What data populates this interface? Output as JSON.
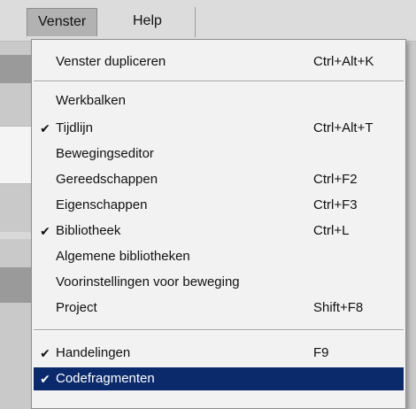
{
  "menubar": {
    "menus": [
      {
        "label": "Venster"
      },
      {
        "label": "Help"
      }
    ]
  },
  "dropdown": {
    "items": [
      {
        "label": "Venster dupliceren",
        "shortcut": "Ctrl+Alt+K",
        "checked": false
      },
      {
        "label": "Werkbalken",
        "shortcut": "",
        "checked": false
      },
      {
        "label": "Tijdlijn",
        "shortcut": "Ctrl+Alt+T",
        "checked": true
      },
      {
        "label": "Bewegingseditor",
        "shortcut": "",
        "checked": false
      },
      {
        "label": "Gereedschappen",
        "shortcut": "Ctrl+F2",
        "checked": false
      },
      {
        "label": "Eigenschappen",
        "shortcut": "Ctrl+F3",
        "checked": false
      },
      {
        "label": "Bibliotheek",
        "shortcut": "Ctrl+L",
        "checked": true
      },
      {
        "label": "Algemene bibliotheken",
        "shortcut": "",
        "checked": false
      },
      {
        "label": "Voorinstellingen voor beweging",
        "shortcut": "",
        "checked": false
      },
      {
        "label": "Project",
        "shortcut": "Shift+F8",
        "checked": false
      },
      {
        "label": "Handelingen",
        "shortcut": "F9",
        "checked": true
      },
      {
        "label": "Codefragmenten",
        "shortcut": "",
        "checked": true,
        "selected": true
      }
    ],
    "check_glyph": "✔",
    "selection_color": "#0b2a6b"
  }
}
